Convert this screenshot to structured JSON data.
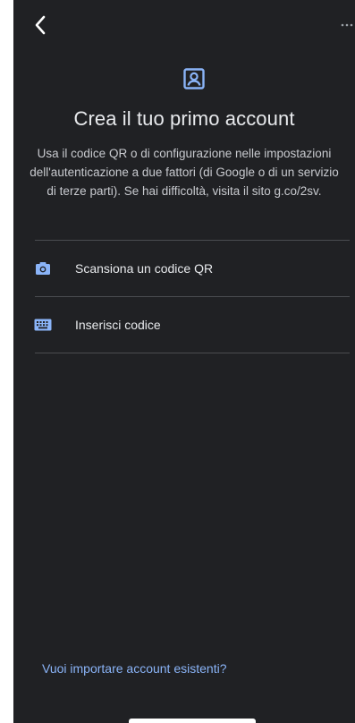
{
  "topbar": {
    "back_icon": "chevron-left-icon",
    "more_icon": "more-horizontal-icon"
  },
  "hero": {
    "icon": "account-box-icon",
    "title": "Crea il tuo primo account",
    "description": "Usa il codice QR o di configurazione nelle impostazioni dell'autenticazione a due fattori (di Google o di un servizio di terze parti). Se hai difficoltà, visita il sito g.co/2sv."
  },
  "options": [
    {
      "icon": "camera-icon",
      "label": "Scansiona un codice QR"
    },
    {
      "icon": "keyboard-icon",
      "label": "Inserisci codice"
    }
  ],
  "footer": {
    "import_link": "Vuoi importare account esistenti?"
  },
  "colors": {
    "background": "#202124",
    "text_primary": "#e8eaed",
    "accent": "#8ab4f8",
    "divider": "#4a4c50"
  }
}
